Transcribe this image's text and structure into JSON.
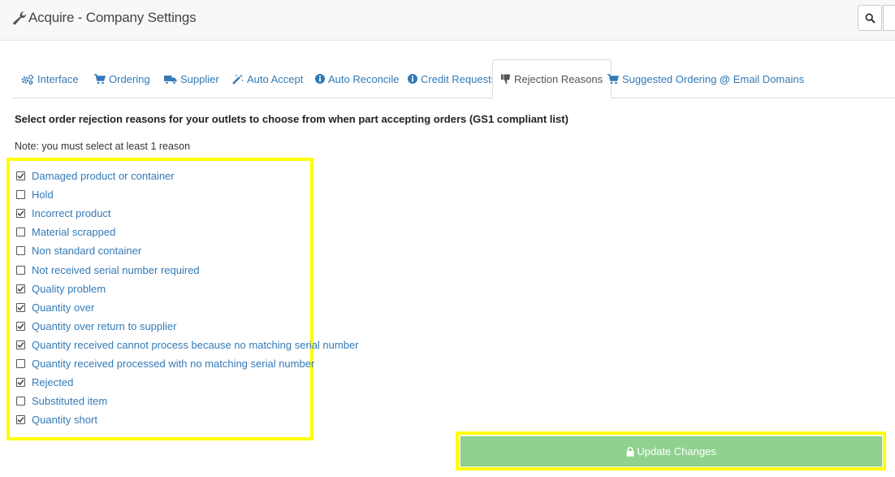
{
  "header": {
    "title": "Acquire - Company Settings",
    "icons": {
      "title": "wrench-icon",
      "search": "search-icon"
    }
  },
  "tabs": [
    {
      "label": "Interface",
      "icon": "gears-icon",
      "active": false
    },
    {
      "label": "Ordering",
      "icon": "cart-icon",
      "active": false
    },
    {
      "label": "Supplier",
      "icon": "truck-icon",
      "active": false
    },
    {
      "label": "Auto Accept",
      "icon": "magic-wand-icon",
      "active": false
    },
    {
      "label": "Auto Reconcile",
      "icon": "info-circle-icon",
      "active": false
    },
    {
      "label": "Credit Requests",
      "icon": "info-circle-icon",
      "active": false
    },
    {
      "label": "Rejection Reasons",
      "icon": "thumbs-down-icon",
      "active": true
    },
    {
      "label": "Suggested Ordering",
      "icon": "cart-icon",
      "active": false
    },
    {
      "label": "Email Domains",
      "icon": "at-icon",
      "active": false
    }
  ],
  "content": {
    "intro": "Select order rejection reasons for your outlets to choose from when part accepting orders (GS1 compliant list)",
    "note": "Note: you must select at least 1 reason",
    "reasons": [
      {
        "label": "Damaged product or container",
        "checked": true
      },
      {
        "label": "Hold",
        "checked": false
      },
      {
        "label": "Incorrect product",
        "checked": true
      },
      {
        "label": "Material scrapped",
        "checked": false
      },
      {
        "label": "Non standard container",
        "checked": false
      },
      {
        "label": "Not received serial number required",
        "checked": false
      },
      {
        "label": "Quality problem",
        "checked": true
      },
      {
        "label": "Quantity over",
        "checked": true
      },
      {
        "label": "Quantity over return to supplier",
        "checked": true
      },
      {
        "label": "Quantity received cannot process because no matching serial number",
        "checked": true
      },
      {
        "label": "Quantity received processed with no matching serial number",
        "checked": false
      },
      {
        "label": "Rejected",
        "checked": true
      },
      {
        "label": "Substituted item",
        "checked": false
      },
      {
        "label": "Quantity short",
        "checked": true
      }
    ]
  },
  "actions": {
    "update_label": "Update Changes",
    "update_icon": "lock-icon"
  },
  "colors": {
    "link": "#337ab7",
    "update_button": "#8fd18f",
    "highlight": "#ffff00"
  }
}
